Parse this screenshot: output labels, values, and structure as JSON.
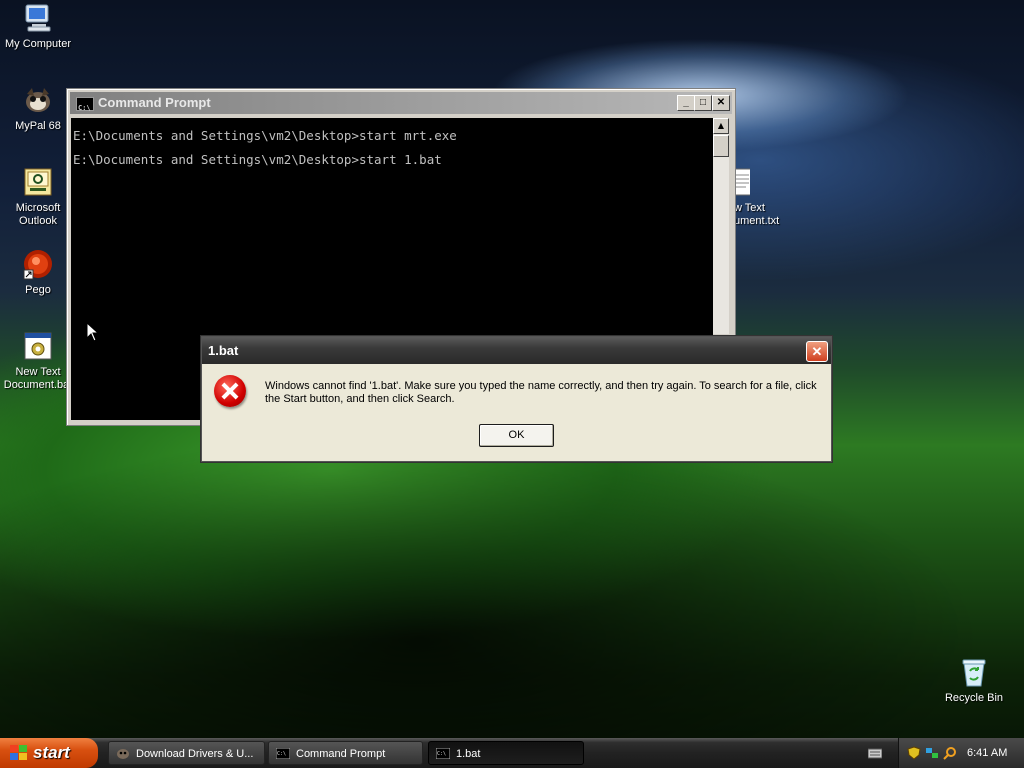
{
  "desktop": {
    "icons": [
      {
        "label": "My Computer",
        "icon": "my-computer-icon"
      },
      {
        "label": "MyPal 68",
        "icon": "mypal-browser-icon"
      },
      {
        "label": "Microsoft Outlook",
        "icon": "outlook-icon"
      },
      {
        "label": "Pego",
        "icon": "pego-app-icon"
      },
      {
        "label": "New Text Document.bat",
        "icon": "batch-file-icon"
      },
      {
        "label": "New Text Document.txt",
        "icon": "text-file-icon",
        "visible_label": "w Text\nument.txt"
      },
      {
        "label": "Recycle Bin",
        "icon": "recycle-bin-icon"
      }
    ]
  },
  "cmd_window": {
    "title": "Command Prompt",
    "lines": [
      "E:\\Documents and Settings\\vm2\\Desktop>start mrt.exe",
      "E:\\Documents and Settings\\vm2\\Desktop>start 1.bat"
    ]
  },
  "error_dialog": {
    "title": "1.bat",
    "message": "Windows cannot find '1.bat'. Make sure you typed the name correctly, and then try again. To search for a file, click the Start button, and then click Search.",
    "ok_label": "OK"
  },
  "taskbar": {
    "start_label": "start",
    "tasks": [
      {
        "label": "Download Drivers & U...",
        "icon": "browser-icon",
        "active": false
      },
      {
        "label": "Command Prompt",
        "icon": "cmd-icon",
        "active": false
      },
      {
        "label": "1.bat",
        "icon": "cmd-icon",
        "active": true
      }
    ],
    "clock": "6:41 AM"
  },
  "colors": {
    "console_bg": "#000000",
    "console_text": "#c0c0c0",
    "start_button": "#d85010",
    "error_red": "#d00000"
  }
}
